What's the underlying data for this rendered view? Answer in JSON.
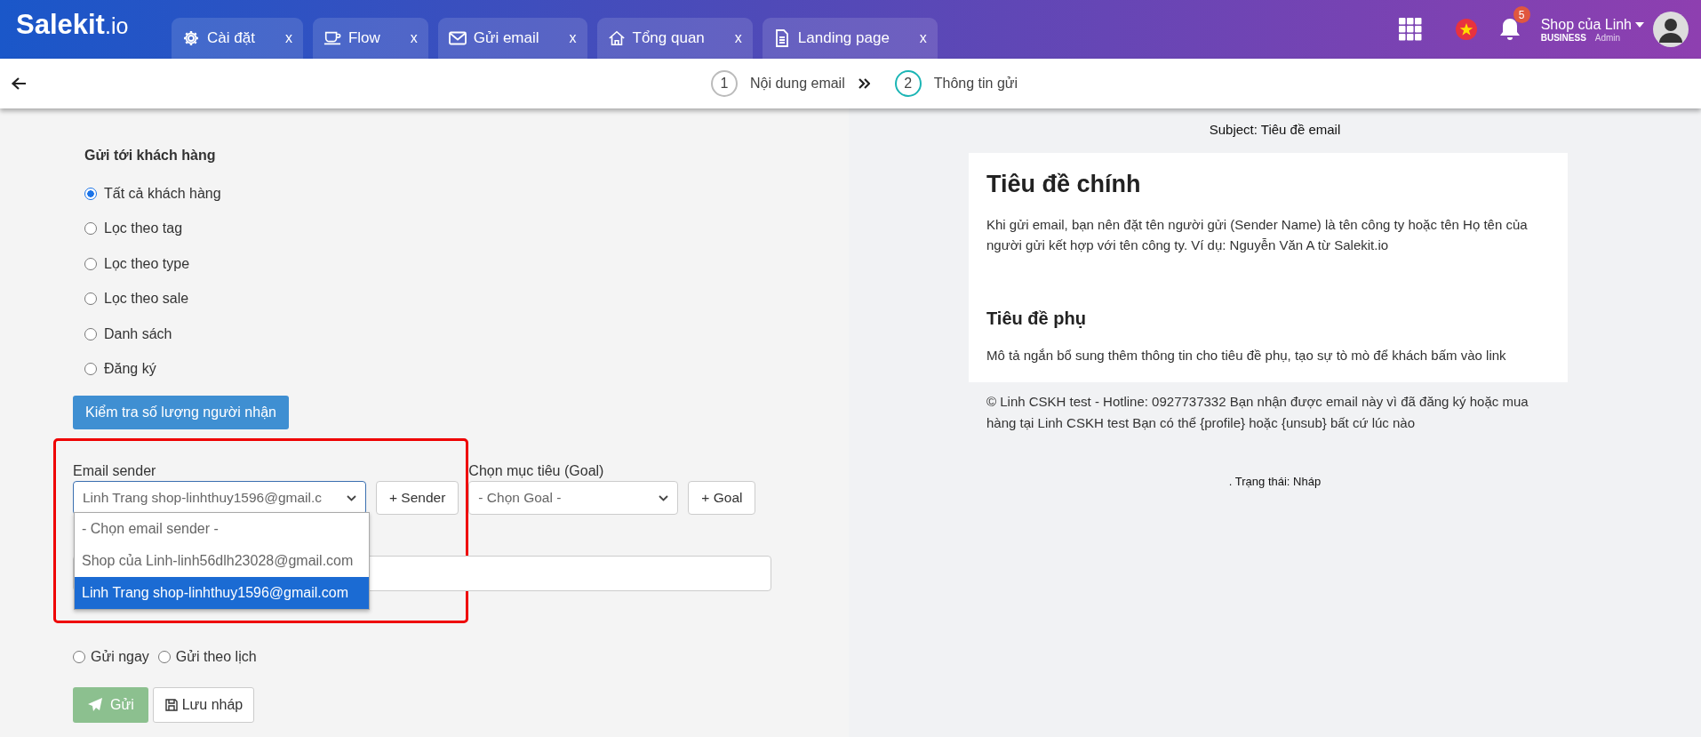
{
  "brand": {
    "name": "Salekit",
    "suffix": ".io"
  },
  "tabs": [
    {
      "label": "Cài đặt",
      "kind": "settings",
      "close": "x"
    },
    {
      "label": "Flow",
      "kind": "flow",
      "close": "x"
    },
    {
      "label": "Gửi email",
      "kind": "email",
      "close": "x"
    },
    {
      "label": "Tổng quan",
      "kind": "overview",
      "close": "x"
    },
    {
      "label": "Landing page",
      "kind": "page",
      "close": "x"
    }
  ],
  "account": {
    "notification_count": "5",
    "shop_name": "Shop của Linh",
    "plan": "BUSINESS",
    "role": "Admin"
  },
  "steps": [
    {
      "number": "1",
      "label": "Nội dung email",
      "selected": false
    },
    {
      "number": "2",
      "label": "Thông tin gửi",
      "selected": true
    }
  ],
  "recipients": {
    "title": "Gửi tới khách hàng",
    "options": [
      {
        "label": "Tất cả khách hàng",
        "selected": true
      },
      {
        "label": "Lọc theo tag",
        "selected": false
      },
      {
        "label": "Lọc theo type",
        "selected": false
      },
      {
        "label": "Lọc theo sale",
        "selected": false
      },
      {
        "label": "Danh sách",
        "selected": false
      },
      {
        "label": "Đăng ký",
        "selected": false
      }
    ],
    "check_button": "Kiểm tra số lượng người nhận"
  },
  "sender": {
    "label": "Email sender",
    "value": "Linh Trang shop-linhthuy1596@gmail.c",
    "add_button": "+ Sender",
    "options": [
      {
        "label": "- Chọn email sender -",
        "selected": false
      },
      {
        "label": "Shop của Linh-linh56dlh23028@gmail.com",
        "selected": false
      },
      {
        "label": "Linh Trang shop-linhthuy1596@gmail.com",
        "selected": true
      }
    ]
  },
  "goal": {
    "label": "Chọn mục tiêu (Goal)",
    "value": "- Chọn Goal -",
    "add_button": "+ Goal"
  },
  "schedule": [
    {
      "label": "Gửi ngay",
      "selected": false
    },
    {
      "label": "Gửi theo lịch",
      "selected": false
    }
  ],
  "actions": {
    "send": "Gửi",
    "draft": "Lưu nháp"
  },
  "preview": {
    "subject": "Subject: Tiêu đề email",
    "heading": "Tiêu đề chính",
    "intro": "Khi gửi email, bạn nên đặt tên người gửi (Sender Name) là tên công ty hoặc tên Họ tên của người gửi kết hợp với tên công ty. Ví dụ: Nguyễn Văn A từ Salekit.io",
    "subheading": "Tiêu đề phụ",
    "description": "Mô tả ngắn bổ sung thêm thông tin cho tiêu đề phụ, tạo sự tò mò để khách bấm vào link",
    "footer": "© Linh CSKH test - Hotline: 0927737332 Bạn nhận được email này vì đã đăng ký hoặc mua hàng tại Linh CSKH test Bạn có thể {profile} hoặc {unsub} bất cứ lúc nào",
    "status": ". Trạng thái: Nháp"
  }
}
